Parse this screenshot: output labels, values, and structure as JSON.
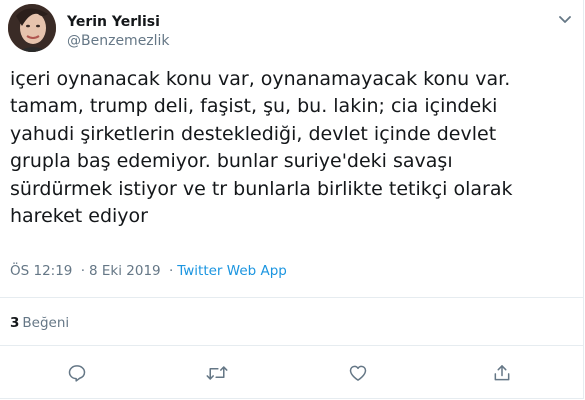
{
  "user": {
    "display_name": "Yerin Yerlisi",
    "handle": "@Benzemezlik"
  },
  "tweet": {
    "lines": [
      "içeri oynanacak konu var, oynanamayacak konu var.",
      "tamam, trump deli, faşist, şu, bu. lakin; cia içindeki",
      "yahudi şirketlerin desteklediği, devlet içinde devlet",
      "grupla baş edemiyor. bunlar suriye'deki savaşı",
      "sürdürmek istiyor ve tr bunlarla birlikte tetikçi olarak",
      "hareket ediyor"
    ],
    "time": "ÖS 12:19",
    "separator": "·",
    "date": "8 Eki 2019",
    "source": "Twitter Web App"
  },
  "stats": {
    "like_count": "3",
    "like_label": "Beğeni"
  },
  "colors": {
    "text": "#14171a",
    "secondary": "#657786",
    "link": "#1b95e0",
    "divider": "#e6ecf0"
  },
  "icons": {
    "caret": "chevron-down-icon",
    "reply": "reply-icon",
    "retweet": "retweet-icon",
    "like": "heart-icon",
    "share": "share-icon"
  }
}
